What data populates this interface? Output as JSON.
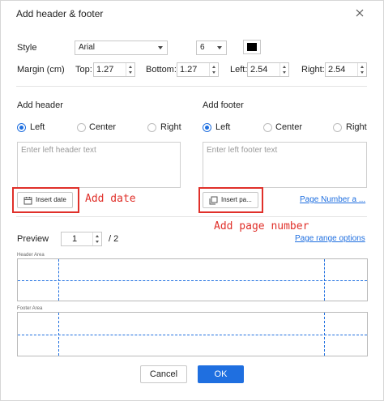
{
  "dialog": {
    "title": "Add header & footer",
    "accent_color": "#1f6fe0",
    "annotation_color": "#e0302a"
  },
  "style": {
    "label": "Style",
    "font": "Arial",
    "size": "6",
    "color": "#000000"
  },
  "margin": {
    "label": "Margin (cm)",
    "top_label": "Top:",
    "top_value": "1.27",
    "bottom_label": "Bottom:",
    "bottom_value": "1.27",
    "left_label": "Left:",
    "left_value": "2.54",
    "right_label": "Right:",
    "right_value": "2.54"
  },
  "header_section": {
    "title": "Add header",
    "align_options": [
      "Left",
      "Center",
      "Right"
    ],
    "selected_align": "Left",
    "placeholder": "Enter left header text",
    "insert_date_label": "Insert date",
    "annotation": "Add date"
  },
  "footer_section": {
    "title": "Add footer",
    "align_options": [
      "Left",
      "Center",
      "Right"
    ],
    "selected_align": "Left",
    "placeholder": "Enter left footer text",
    "insert_page_label": "Insert pa...",
    "page_number_link": "Page Number a ...",
    "annotation": "Add page number"
  },
  "preview": {
    "label": "Preview",
    "page_value": "1",
    "page_total": "/ 2",
    "page_range_link": "Page range options",
    "header_area_label": "Header Area",
    "footer_area_label": "Footer Area"
  },
  "buttons": {
    "cancel": "Cancel",
    "ok": "OK"
  }
}
